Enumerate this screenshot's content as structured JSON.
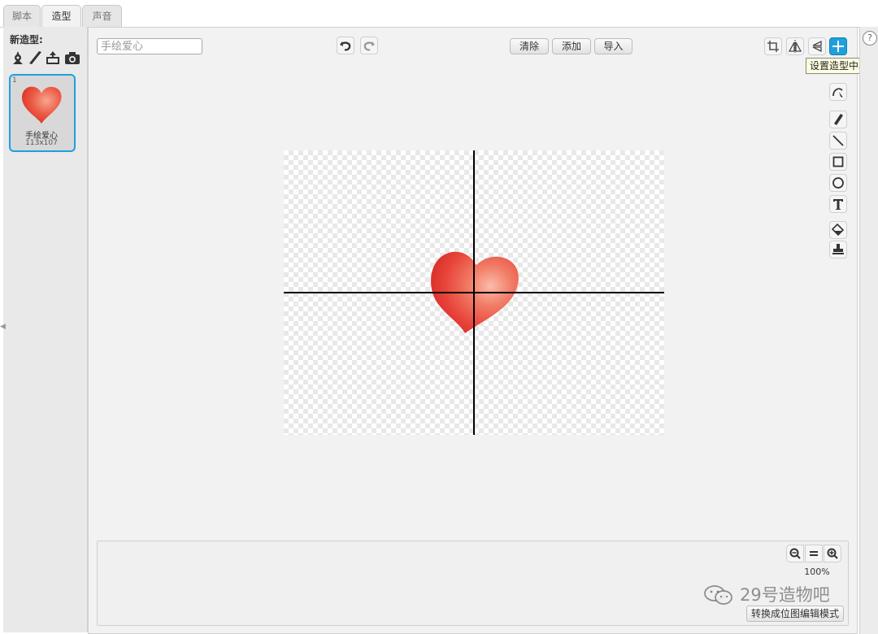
{
  "tabs": [
    {
      "label": "脚本",
      "active": false
    },
    {
      "label": "造型",
      "active": true
    },
    {
      "label": "声音",
      "active": false
    }
  ],
  "left_panel": {
    "new_costume_label": "新造型:",
    "new_costume_icons": [
      "paint-from-library-icon",
      "paint-new-icon",
      "upload-icon",
      "camera-icon"
    ],
    "costume": {
      "index": "1",
      "name": "手绘爱心",
      "size": "113x107"
    }
  },
  "editor": {
    "costume_name_value": "手绘爱心",
    "toolbar": {
      "clear": "清除",
      "add": "添加",
      "import": "导入"
    },
    "tooltip": "设置造型中心",
    "zoom": "100%",
    "convert_button": "转换成位图编辑模式",
    "accent_color": "#1ea0dc"
  },
  "watermark": "29号造物吧",
  "help_icon": "?"
}
